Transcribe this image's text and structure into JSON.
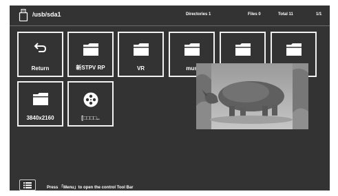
{
  "header": {
    "path": "/usb/sda1",
    "directories": "Directories 1",
    "files": "Files 0",
    "total": "Total 11",
    "page": "1/1"
  },
  "tiles": [
    {
      "label": "Return",
      "icon": "return-icon"
    },
    {
      "label": "新STPV   RP",
      "icon": "folder-icon"
    },
    {
      "label": "VR",
      "icon": "folder-icon"
    },
    {
      "label": "mus",
      "icon": "folder-icon"
    },
    {
      "label": "",
      "icon": "folder-icon"
    },
    {
      "label": "",
      "icon": "folder-icon"
    },
    {
      "label": "3840x2160",
      "icon": "folder-icon"
    },
    {
      "label": "[□□□□..",
      "icon": "film-reel-icon"
    }
  ],
  "preview": {
    "subject": "rhino-photo"
  },
  "footer": {
    "hint": "Press 「Menu」to open the control Tool Bar",
    "menu_icon": "menu-list-icon"
  },
  "colors": {
    "background": "#333333",
    "tile_border": "#f2f2f2",
    "text": "#ffffff"
  }
}
